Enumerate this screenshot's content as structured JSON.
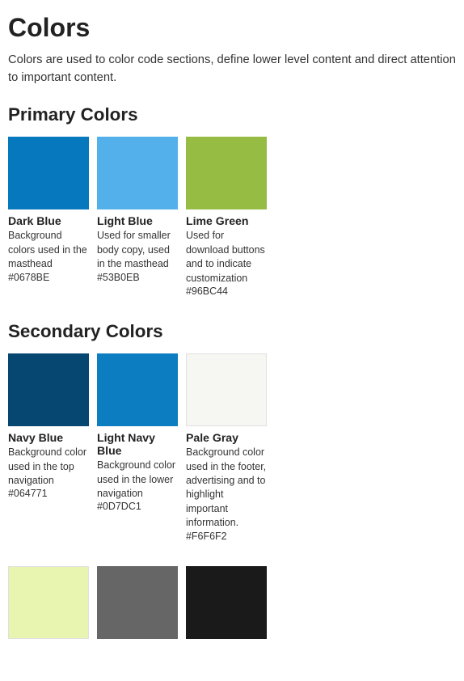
{
  "page": {
    "title": "Colors",
    "intro": "Colors are used to color code sections, define lower level content and direct attention to important content."
  },
  "primaryColors": {
    "heading": "Primary Colors",
    "items": [
      {
        "name": "Dark Blue",
        "hex": "#0678BE",
        "hexDisplay": "#0678BE",
        "description": "Background colors used in the masthead"
      },
      {
        "name": "Light Blue",
        "hex": "#53B0EB",
        "hexDisplay": "#53B0EB",
        "description": "Used for smaller body copy, used in the masthead"
      },
      {
        "name": "Lime Green",
        "hex": "#96BC44",
        "hexDisplay": "#96BC44",
        "description": "Used for download buttons and to indicate customization"
      }
    ]
  },
  "secondaryColors": {
    "heading": "Secondary Colors",
    "items": [
      {
        "name": "Navy Blue",
        "hex": "#064771",
        "hexDisplay": "#064771",
        "description": "Background color used in the top navigation"
      },
      {
        "name": "Light Navy Blue",
        "hex": "#0D7DC1",
        "hexDisplay": "#0D7DC1",
        "description": "Background color used in the lower navigation"
      },
      {
        "name": "Pale Gray",
        "hex": "#F6F6F2",
        "hexDisplay": "#F6F6F2",
        "description": "Background color used in the footer, advertising and to highlight important information."
      }
    ]
  },
  "tertiaryColors": {
    "items": [
      {
        "name": "",
        "hex": "#E8F5B0",
        "hexDisplay": "",
        "description": ""
      },
      {
        "name": "",
        "hex": "#666666",
        "hexDisplay": "",
        "description": ""
      },
      {
        "name": "",
        "hex": "#1A1A1A",
        "hexDisplay": "",
        "description": ""
      }
    ]
  }
}
